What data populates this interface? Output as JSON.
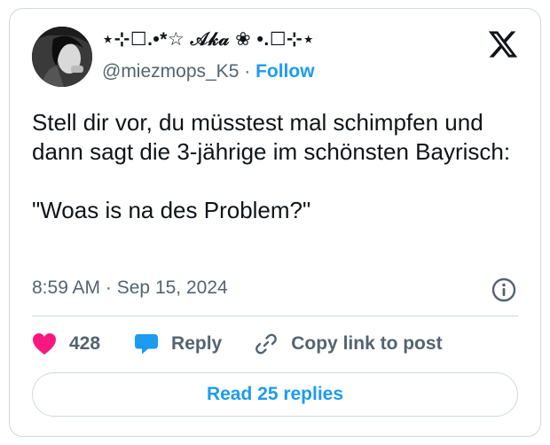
{
  "author": {
    "display_name": "⋆⊹☐.•*☆ 𝒜𝓀𝒶 ❀ •.☐⊹⋆",
    "handle": "@miezmops_K5",
    "separator": "·",
    "follow_label": "Follow"
  },
  "tweet": {
    "text": "Stell dir vor, du müsstest mal schimpfen und dann sagt die 3-jährige im schönsten Bayrisch:\n\n\"Woas is na des Problem?\"",
    "time": "8:59 AM",
    "date": "Sep 15, 2024",
    "meta_separator": "·"
  },
  "actions": {
    "like_count": "428",
    "reply_label": "Reply",
    "copy_link_label": "Copy link to post"
  },
  "footer": {
    "read_replies_label": "Read 25 replies"
  },
  "colors": {
    "accent": "#1d9bf0",
    "like": "#f91880",
    "secondary_text": "#536471",
    "border": "#cfd9de"
  },
  "icons": {
    "logo": "x-logo-icon",
    "info": "info-icon",
    "like": "heart-icon",
    "reply": "speech-bubble-icon",
    "copy": "link-icon"
  }
}
